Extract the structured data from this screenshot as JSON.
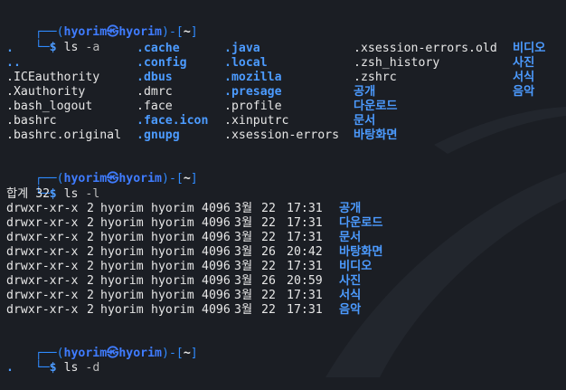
{
  "prompt": {
    "user": "hyorim",
    "separator": "㉿",
    "host": "hyorim",
    "dir": "~",
    "frame_top_left": "┌──(",
    "frame_mid": ")-[",
    "frame_end": "]",
    "frame_bottom": "└─",
    "dollar": "$"
  },
  "commands": [
    {
      "cmd": "ls",
      "arg": "-a"
    },
    {
      "cmd": "ls",
      "arg": "-l"
    },
    {
      "cmd": "ls",
      "arg": "-d"
    }
  ],
  "ls_a": {
    "col1": [
      ".",
      "..",
      ".ICEauthority",
      ".Xauthority",
      ".bash_logout",
      ".bashrc",
      ".bashrc.original"
    ],
    "col1_dir": [
      true,
      true,
      false,
      false,
      false,
      false,
      false
    ],
    "col2": [
      ".cache",
      ".config",
      ".dbus",
      ".dmrc",
      ".face",
      ".face.icon",
      ".gnupg"
    ],
    "col2_dir": [
      true,
      true,
      true,
      false,
      false,
      true,
      true
    ],
    "col3": [
      ".java",
      ".local",
      ".mozilla",
      ".presage",
      ".profile",
      ".xinputrc",
      ".xsession-errors"
    ],
    "col3_dir": [
      true,
      true,
      true,
      true,
      false,
      false,
      false
    ],
    "col4": [
      ".xsession-errors.old",
      ".zsh_history",
      ".zshrc",
      "공개",
      "다운로드",
      "문서",
      "바탕화면"
    ],
    "col4_dir": [
      false,
      false,
      false,
      true,
      true,
      true,
      true
    ],
    "col5": [
      "비디오",
      "사진",
      "서식",
      "음악"
    ],
    "col5_dir": [
      true,
      true,
      true,
      true
    ]
  },
  "ls_l": {
    "total": "합계 32",
    "rows": [
      {
        "perm": "drwxr-xr-x",
        "links": "2",
        "owner": "hyorim",
        "group": "hyorim",
        "size": "4096",
        "month": "3월",
        "day": "22",
        "time": "17:31",
        "name": "공개"
      },
      {
        "perm": "drwxr-xr-x",
        "links": "2",
        "owner": "hyorim",
        "group": "hyorim",
        "size": "4096",
        "month": "3월",
        "day": "22",
        "time": "17:31",
        "name": "다운로드"
      },
      {
        "perm": "drwxr-xr-x",
        "links": "2",
        "owner": "hyorim",
        "group": "hyorim",
        "size": "4096",
        "month": "3월",
        "day": "22",
        "time": "17:31",
        "name": "문서"
      },
      {
        "perm": "drwxr-xr-x",
        "links": "2",
        "owner": "hyorim",
        "group": "hyorim",
        "size": "4096",
        "month": "3월",
        "day": "26",
        "time": "20:42",
        "name": "바탕화면"
      },
      {
        "perm": "drwxr-xr-x",
        "links": "2",
        "owner": "hyorim",
        "group": "hyorim",
        "size": "4096",
        "month": "3월",
        "day": "22",
        "time": "17:31",
        "name": "비디오"
      },
      {
        "perm": "drwxr-xr-x",
        "links": "2",
        "owner": "hyorim",
        "group": "hyorim",
        "size": "4096",
        "month": "3월",
        "day": "26",
        "time": "20:59",
        "name": "사진"
      },
      {
        "perm": "drwxr-xr-x",
        "links": "2",
        "owner": "hyorim",
        "group": "hyorim",
        "size": "4096",
        "month": "3월",
        "day": "22",
        "time": "17:31",
        "name": "서식"
      },
      {
        "perm": "drwxr-xr-x",
        "links": "2",
        "owner": "hyorim",
        "group": "hyorim",
        "size": "4096",
        "month": "3월",
        "day": "22",
        "time": "17:31",
        "name": "음악"
      }
    ]
  },
  "ls_d": {
    "output": "."
  },
  "colors": {
    "background": "#1b1e24",
    "directory": "#4c9bff",
    "text": "#e6e6e6",
    "prompt_frame": "#2f8bff",
    "command_arg": "#b9b9b9"
  }
}
